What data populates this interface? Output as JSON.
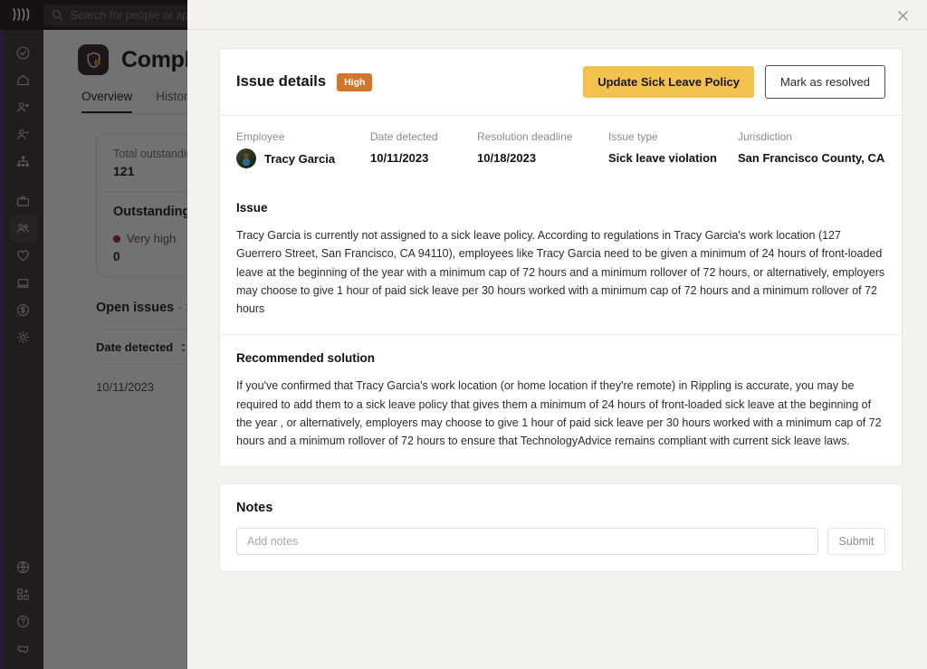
{
  "background": {
    "brand": {
      "logo_text": "քքք"
    },
    "search": {
      "placeholder": "Search for people or apps",
      "icon": "search-icon"
    },
    "sidebar": {
      "top_items": [
        {
          "icon": "check-circle-icon",
          "name": "tasks"
        },
        {
          "icon": "home-icon",
          "name": "home"
        },
        {
          "icon": "person-add-icon",
          "name": "onboarding"
        },
        {
          "icon": "person-remove-icon",
          "name": "offboarding"
        },
        {
          "icon": "org-chart-icon",
          "name": "org-chart"
        },
        {
          "icon": "briefcase-icon",
          "name": "jobs"
        },
        {
          "icon": "people-icon",
          "name": "people",
          "selected": true
        },
        {
          "icon": "heart-icon",
          "name": "benefits"
        },
        {
          "icon": "laptop-icon",
          "name": "devices"
        },
        {
          "icon": "dollar-circle-icon",
          "name": "payroll"
        },
        {
          "icon": "gear-icon",
          "name": "settings"
        }
      ],
      "bottom_items": [
        {
          "icon": "globe-icon",
          "name": "global"
        },
        {
          "icon": "apps-add-icon",
          "name": "apps"
        },
        {
          "icon": "help-circle-icon",
          "name": "help"
        },
        {
          "icon": "handshake-icon",
          "name": "partners"
        }
      ]
    },
    "page": {
      "app_icon": "shield-warning-icon",
      "title": "Compliance",
      "tabs": [
        {
          "label": "Overview",
          "active": true
        },
        {
          "label": "Historical",
          "active": false
        }
      ],
      "stats": {
        "total_label": "Total outstanding issues",
        "total_value": "121",
        "outstanding_heading": "Outstanding issues",
        "severities": [
          {
            "name": "Very high",
            "count": "0",
            "color": "#8f2119"
          }
        ]
      },
      "table": {
        "heading": "Open issues",
        "heading_suffix": "· Show",
        "columns": [
          {
            "label": "Date detected",
            "sortable": true
          }
        ],
        "rows": [
          {
            "date_detected": "10/11/2023"
          }
        ]
      }
    }
  },
  "modal": {
    "close_icon": "close-icon",
    "header": {
      "title": "Issue details",
      "priority_badge": "High",
      "priority_color": "#d0772e",
      "primary_action": "Update Sick Leave Policy",
      "primary_color": "#f2c14e",
      "secondary_action": "Mark as resolved"
    },
    "meta": [
      {
        "label": "Employee",
        "value": "Tracy Garcia",
        "has_avatar": true
      },
      {
        "label": "Date detected",
        "value": "10/11/2023",
        "has_avatar": false
      },
      {
        "label": "Resolution deadline",
        "value": "10/18/2023",
        "has_avatar": false
      },
      {
        "label": "Issue type",
        "value": "Sick leave violation",
        "has_avatar": false
      },
      {
        "label": "Jurisdiction",
        "value": "San Francisco County, CA",
        "has_avatar": false
      }
    ],
    "issue": {
      "title": "Issue",
      "body": "Tracy Garcia is currently not assigned to a sick leave policy. According to regulations in Tracy Garcia's work location (127 Guerrero Street, San Francisco, CA 94110), employees like Tracy Garcia need to be given a minimum of 24 hours of front-loaded leave at the beginning of the year with a minimum cap of 72 hours and a minimum rollover of 72 hours, or alternatively, employers may choose to give 1 hour of paid sick leave per 30 hours worked with a minimum cap of 72 hours and a minimum rollover of 72 hours"
    },
    "solution": {
      "title": "Recommended solution",
      "body": "If you've confirmed that Tracy Garcia's work location (or home location if they're remote) in Rippling is accurate, you may be required to add them to a sick leave policy that gives them a minimum of 24 hours of front-loaded sick leave at the beginning of the year , or alternatively, employers may choose to give 1 hour of paid sick leave per 30 hours worked with a minimum cap of 72 hours and a minimum rollover of 72 hours to ensure that TechnologyAdvice remains compliant with current sick leave laws."
    },
    "notes": {
      "title": "Notes",
      "input_value": "",
      "input_placeholder": "Add notes",
      "submit_label": "Submit"
    }
  }
}
